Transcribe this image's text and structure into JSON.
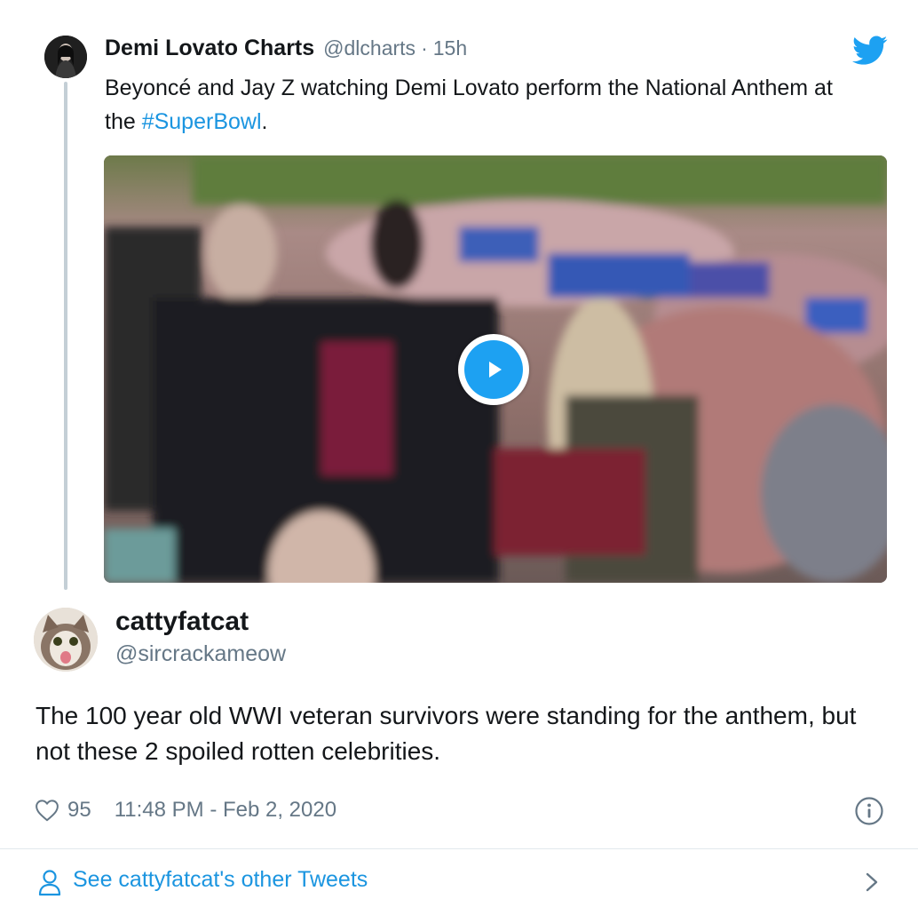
{
  "parent_tweet": {
    "avatar_icon": "profile-photo-dark",
    "name": "Demi Lovato Charts",
    "handle": "@dlcharts",
    "separator": "·",
    "time": "15h",
    "text_before": "Beyoncé and Jay Z watching Demi Lovato perform the National Anthem at the ",
    "hashtag": "#SuperBowl",
    "text_after": ".",
    "media": {
      "type": "video",
      "play_icon": "play-icon"
    },
    "brand_icon": "twitter-bird-icon"
  },
  "tweet": {
    "avatar_icon": "cat-photo",
    "name": "cattyfatcat",
    "handle": "@sircrackameow",
    "text": "The 100 year old WWI veteran survivors were standing for the anthem, but not these 2 spoiled rotten celebrities.",
    "likes": "95",
    "timestamp": "11:48 PM - Feb 2, 2020"
  },
  "footer": {
    "link_label": "See cattyfatcat's other Tweets"
  },
  "colors": {
    "link": "#1b95e0",
    "twitter_blue": "#1da1f2",
    "secondary_text": "#657786",
    "primary_text": "#14171a",
    "thread_line": "#c4cfd6",
    "divider": "#e1e8ed"
  }
}
